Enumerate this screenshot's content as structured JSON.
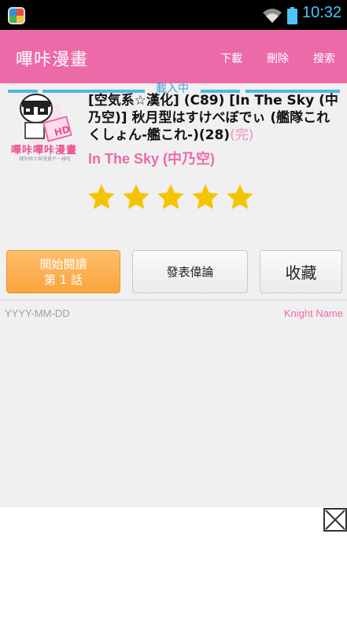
{
  "status_bar": {
    "time": "10:32",
    "app_icon": "multicolor-app-icon",
    "wifi_icon": "wifi-icon",
    "battery_icon": "battery-icon",
    "accent": "#4fc3f7"
  },
  "action_bar": {
    "title": "嗶咔漫畫",
    "actions": {
      "download": "下載",
      "delete": "刪除",
      "search": "搜索"
    },
    "color": "#ec6aa8"
  },
  "loading": {
    "label": "載入中",
    "color": "#4fb7e8"
  },
  "comic": {
    "cover_brand": "嗶咔嗶咔漫畫",
    "cover_tagline": "讓你紳士與漫畫不一樣啦",
    "title": "[空気系☆漢化] (C89) [In The Sky (中乃空)] 秋月型はすけべぼでぃ (艦隊これくしょん-艦これ-)(28)",
    "status": "(完)",
    "author": "In The Sky (中乃空)",
    "rating": 5,
    "rating_max": 5,
    "star_color": "#f5c400"
  },
  "buttons": {
    "read_line1": "開始閱讀",
    "read_line2": "第 1 話",
    "comment": "發表偉論",
    "favorite": "收藏"
  },
  "meta": {
    "date": "YYYY-MM-DD",
    "uploader": "Knight Name"
  },
  "ad": {
    "close_icon": "close-icon"
  }
}
